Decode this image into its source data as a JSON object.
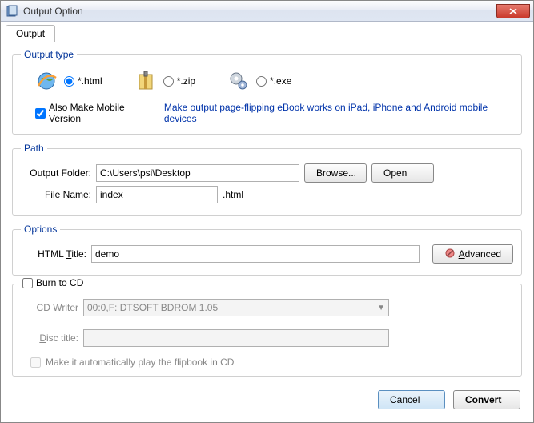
{
  "window": {
    "title": "Output Option"
  },
  "tab": {
    "label": "Output"
  },
  "outputType": {
    "legend": "Output type",
    "options": {
      "html": "*.html",
      "zip": "*.zip",
      "exe": "*.exe"
    },
    "selected": "html",
    "mobileCheckboxLabel": "Also Make Mobile Version",
    "mobileHint": "Make output page-flipping eBook works on iPad, iPhone and Android mobile devices"
  },
  "path": {
    "legend": "Path",
    "folderLabel": "Output Folder:",
    "folderValue": "C:\\Users\\psi\\Desktop",
    "browseLabel": "Browse...",
    "openLabel": "Open",
    "fileLabelPrefix": "File ",
    "fileLabelUnd": "N",
    "fileLabelSuffix": "ame:",
    "fileValue": "index",
    "extension": ".html"
  },
  "options": {
    "legend": "Options",
    "htmlTitlePrefix": "HTML ",
    "htmlTitleUnd": "T",
    "htmlTitleSuffix": "itle:",
    "htmlTitleValue": "demo",
    "advancedUnd": "A",
    "advancedRest": "dvanced"
  },
  "burn": {
    "checkboxLabel": "Burn to CD",
    "cdWriterPrefix": "CD ",
    "cdWriterUnd": "W",
    "cdWriterSuffix": "riter",
    "cdWriterValue": "00:0,F: DTSOFT   BDROM          1.05",
    "discPrefix": "",
    "discUnd": "D",
    "discSuffix": "isc title:",
    "discValue": "",
    "autoPlayLabel": "Make it automatically play the flipbook in CD"
  },
  "footer": {
    "cancel": "Cancel",
    "convert": "Convert"
  }
}
